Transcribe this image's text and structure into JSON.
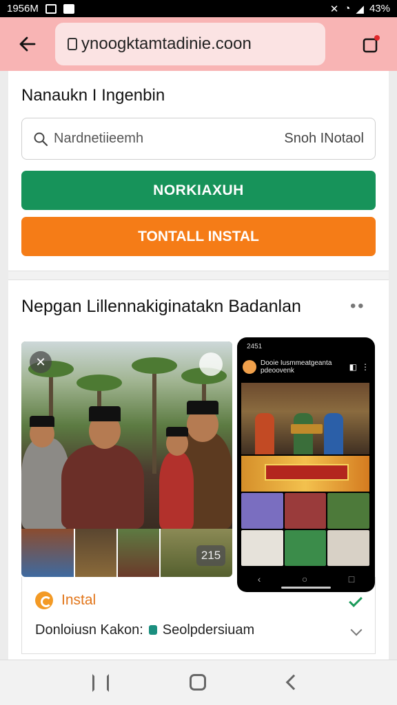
{
  "status_bar": {
    "time": "1956M",
    "battery": "43%"
  },
  "browser": {
    "url": "ynoogktamtadinie.coon"
  },
  "section1": {
    "title": "Nanaukn I Ingenbin",
    "search": {
      "placeholder": "Nardnetiieemh",
      "right_label": "Snoh INotaol"
    },
    "primary_button": "NORKIAXUH",
    "secondary_button": "TONTALL INSTAL"
  },
  "section2": {
    "title": "Nepgan Lillennakiginatakn Badanlan",
    "photo_count": "215",
    "phone_preview": {
      "time": "2451",
      "app_name": "Dooie Iusmmeatgeanta pdeoovenk"
    },
    "install_label": "Instal",
    "developer": "Donloiusn Kakon:",
    "publisher": "Seolpdersiuam"
  },
  "colors": {
    "primary": "#17935a",
    "secondary": "#f57c17",
    "toolbar": "#f8b4b4"
  }
}
